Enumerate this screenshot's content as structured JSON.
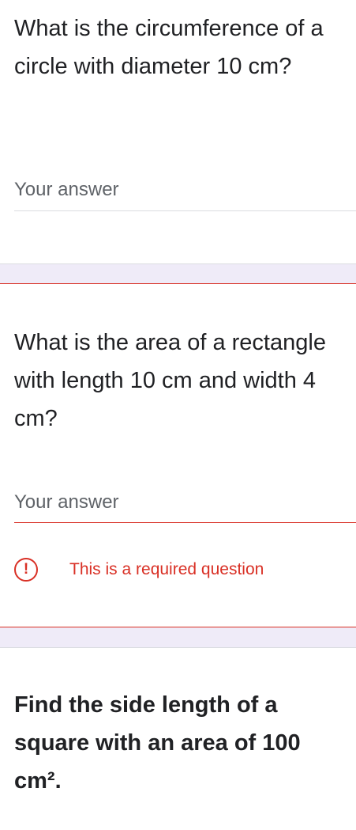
{
  "questions": [
    {
      "title": "What is the circumference of a circle with diameter 10 cm?",
      "answer_placeholder": "Your answer"
    },
    {
      "title": "What is the area of a rectangle with length 10 cm and width 4 cm?",
      "answer_placeholder": "Your answer",
      "error_message": "This is a required question",
      "error_icon_glyph": "!"
    },
    {
      "title": "Find the side length of a square with an area of 100 cm².",
      "answer_placeholder": ""
    }
  ],
  "colors": {
    "error": "#d93025",
    "separator_background": "#efebf8",
    "divider": "#dadce0"
  }
}
